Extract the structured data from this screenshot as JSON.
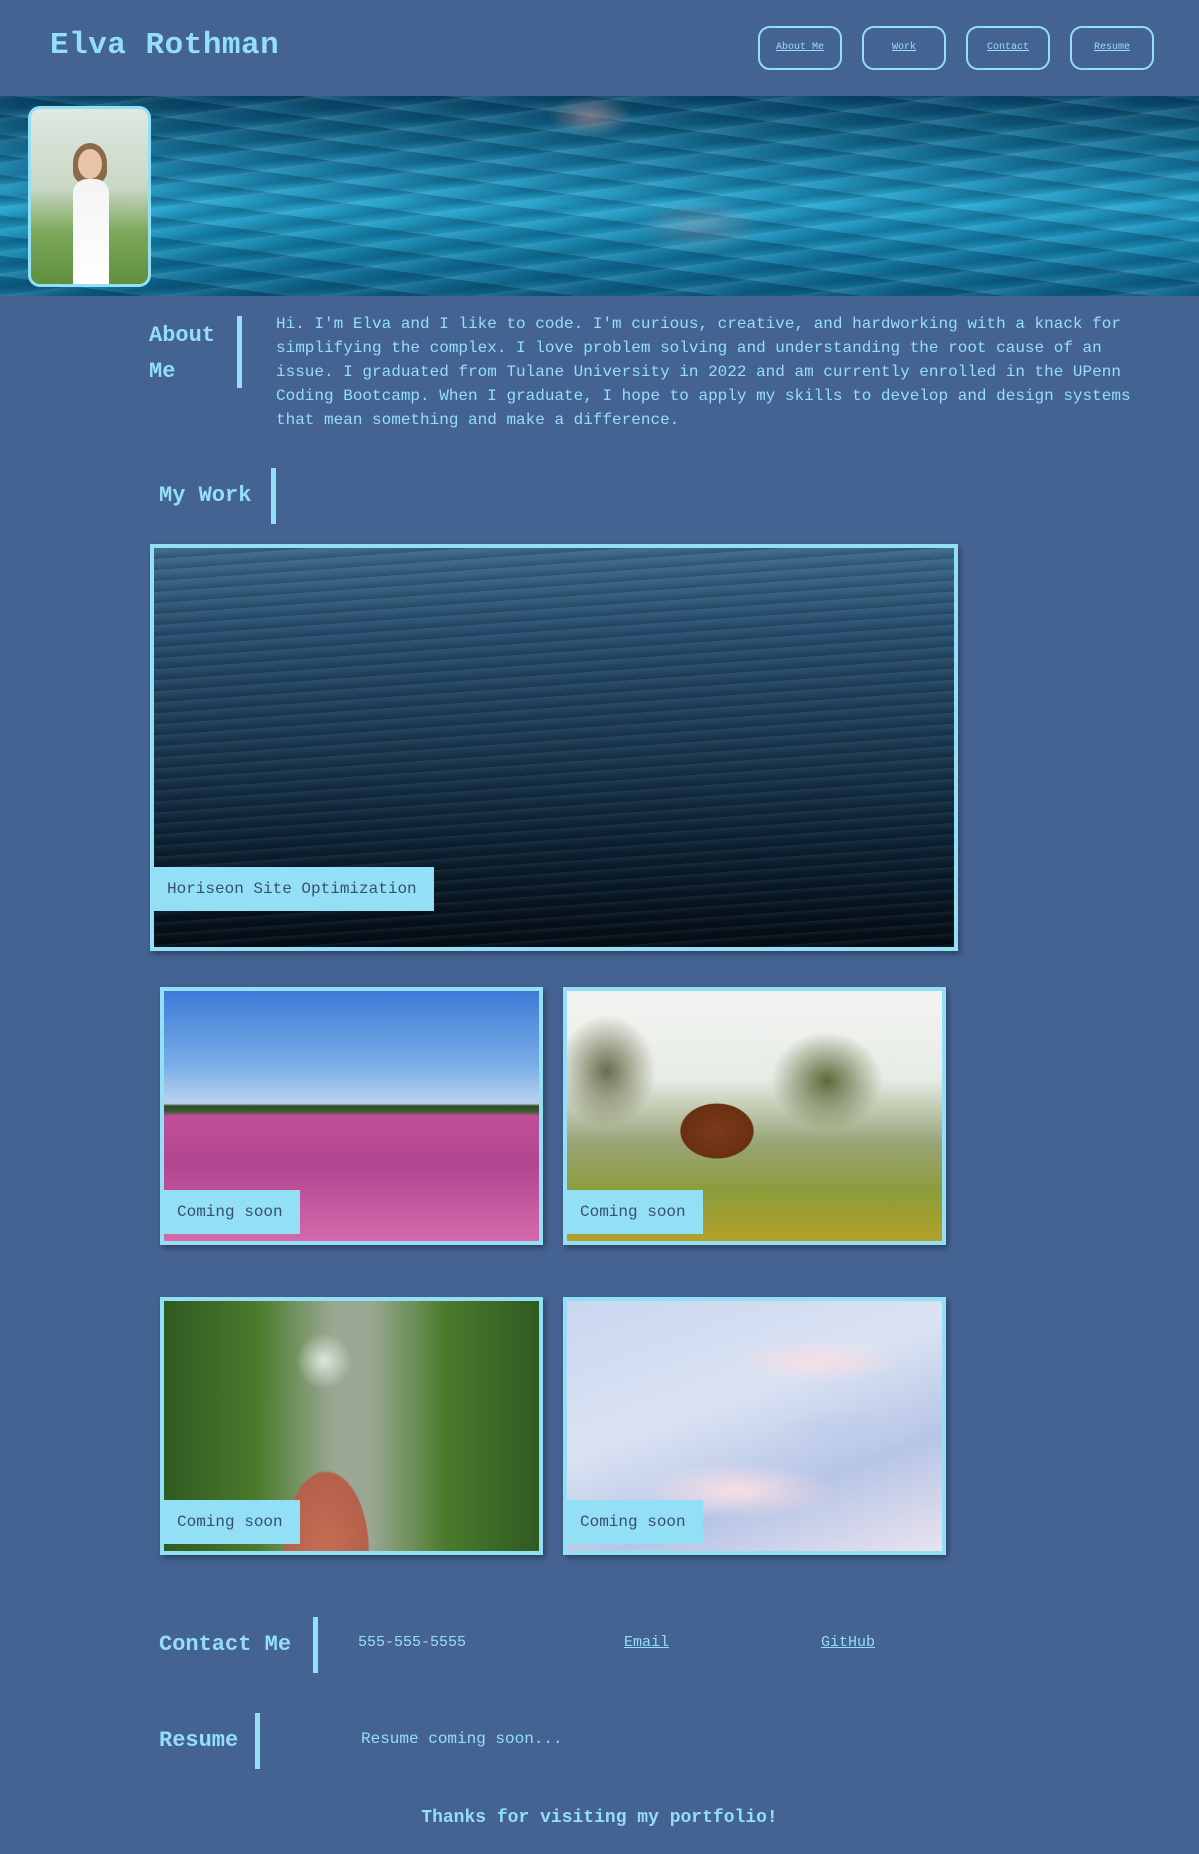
{
  "header": {
    "title": "Elva Rothman",
    "nav": [
      "About Me",
      "Work",
      "Contact",
      "Resume"
    ]
  },
  "about": {
    "heading": "About Me",
    "text": "Hi. I'm Elva and I like to code. I'm curious, creative, and hardworking with a knack for simplifying the complex. I love problem solving and understanding the root cause of an issue. I graduated from Tulane University in 2022 and am currently enrolled in the UPenn Coding Bootcamp. When I graduate, I hope to apply my skills to develop and design systems that mean something and make a difference."
  },
  "work": {
    "heading": "My Work",
    "featured": "Horiseon Site Optimization",
    "projects": [
      "Coming soon",
      "Coming soon",
      "Coming soon",
      "Coming soon"
    ]
  },
  "contact": {
    "heading": "Contact Me",
    "phone": "555-555-5555",
    "email": "Email",
    "github": "GitHub"
  },
  "resume": {
    "heading": "Resume",
    "text": "Resume coming soon..."
  },
  "footer": {
    "text": "Thanks for visiting my portfolio!"
  },
  "colors": {
    "background": "#456392",
    "accent": "#93dff5"
  }
}
